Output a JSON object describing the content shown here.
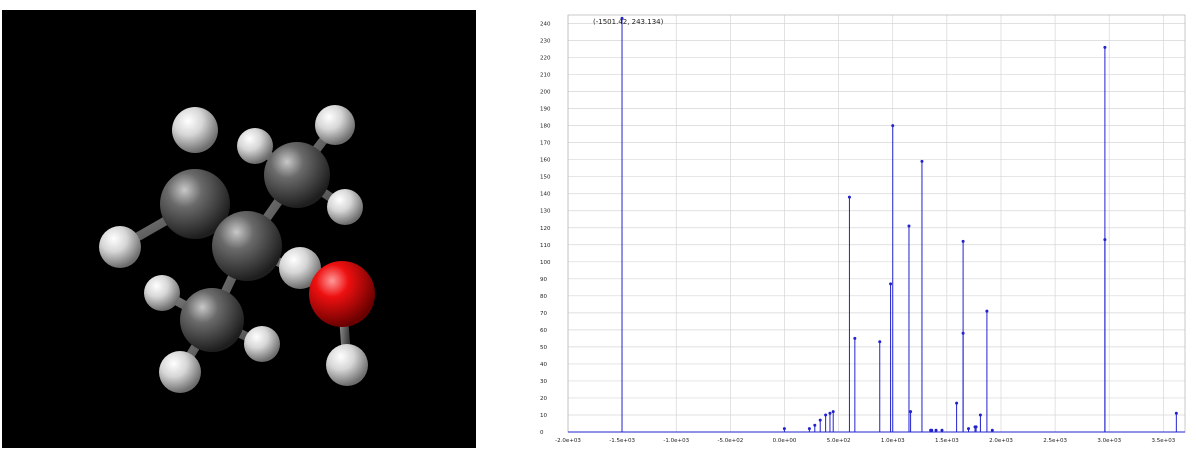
{
  "viewer": {
    "title": "molecule-3d-view",
    "background": "#000000",
    "atom_colors": {
      "carbon": "#5f5f5f",
      "hydrogen": "#d9d9d9",
      "oxygen": "#e00000"
    }
  },
  "spectrum": {
    "cursor_readout": "(-1501.42, 243.134)",
    "line_color": "#2222cc",
    "grid_color": "#d6d6d6"
  },
  "chart_data": {
    "type": "bar",
    "title": "",
    "xlabel": "",
    "ylabel": "",
    "xlim": [
      -2000,
      3700
    ],
    "ylim": [
      0,
      245
    ],
    "grid": true,
    "x_ticks": [
      "-2.0e+03",
      "-1.5e+03",
      "-1.0e+03",
      "-5.0e+02",
      "0.0e+00",
      "5.0e+02",
      "1.0e+03",
      "1.5e+03",
      "2.0e+03",
      "2.5e+03",
      "3.0e+03",
      "3.5e+03"
    ],
    "x_tick_values": [
      -2000,
      -1500,
      -1000,
      -500,
      0,
      500,
      1000,
      1500,
      2000,
      2500,
      3000,
      3500
    ],
    "y_ticks": [
      "0",
      "10",
      "20",
      "30",
      "40",
      "50",
      "60",
      "70",
      "80",
      "90",
      "100",
      "110",
      "120",
      "130",
      "140",
      "150",
      "160",
      "170",
      "180",
      "190",
      "200",
      "210",
      "220",
      "230",
      "240"
    ],
    "y_tick_values": [
      0,
      10,
      20,
      30,
      40,
      50,
      60,
      70,
      80,
      90,
      100,
      110,
      120,
      130,
      140,
      150,
      160,
      170,
      180,
      190,
      200,
      210,
      220,
      230,
      240
    ],
    "series": [
      {
        "x": [
          -1501,
          -1,
          230,
          280,
          330,
          380,
          420,
          450,
          600,
          650,
          880,
          980,
          1000,
          1150,
          1165,
          1270,
          1360,
          1590,
          1650,
          1700,
          1770,
          1810,
          1870,
          1920,
          2960,
          3620
        ],
        "values": [
          243,
          2,
          2,
          4,
          7,
          10,
          11,
          12,
          138,
          55,
          53,
          87,
          180,
          121,
          12,
          159,
          1,
          17,
          112,
          2,
          3,
          10,
          71,
          1,
          113,
          11
        ]
      },
      {
        "x": [
          1350,
          1400,
          1455,
          1650,
          1760,
          2960
        ],
        "values": [
          1,
          1,
          1,
          58,
          3,
          226
        ]
      }
    ]
  }
}
